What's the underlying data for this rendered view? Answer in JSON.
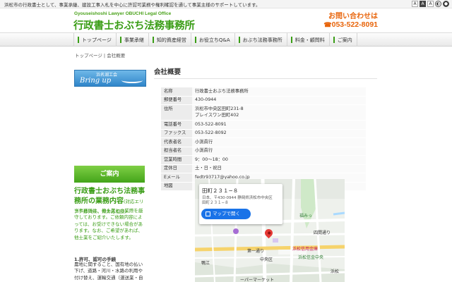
{
  "topbar": {
    "tagline": "浜松市の行政書士として、事業承継、建設工事入札を中心に許認可業務や権利確認を通して事業主様のサポートしています。",
    "font_small": "A",
    "font_mid": "A",
    "font_large": "A"
  },
  "header": {
    "subtitle": "Gyouseishoshi Lawyer OBUCHI Legal Office",
    "title": "行政書士おぶち法務事務所",
    "contact_label": "お問い合わせは",
    "phone_icon": "☎",
    "phone": "053-522-8091"
  },
  "nav": {
    "items": [
      {
        "label": "トップページ"
      },
      {
        "label": "事業承継"
      },
      {
        "label": "知的資産経営"
      },
      {
        "label": "お役立ちQ&A"
      },
      {
        "label": "おぶち法務事務所"
      },
      {
        "label": "料金・顧問料"
      },
      {
        "label": "ご案内"
      }
    ]
  },
  "breadcrumb": {
    "text": "トップページ | 会社概要"
  },
  "sidebar": {
    "banner_top": "浜名湖工会",
    "banner_main": "Bring up",
    "guide_button": "ご案内",
    "heading": "行政書士おぶち法務事務所の業務内容",
    "heading_note": "(対応エリア：静岡県、県外応相談)",
    "body": "当事務所は、他士業との業際を厳守しております。ご依頼内容によっては、お受けできない場合があります。なお、ご希望があれば、他士業をご紹介いたします。",
    "section_title": "1.許可、認可の手続",
    "section_body": "農地に関すること、国有地の払い下げ、道路・河川・水路の利用や付け替え、運輸交通（運送業・自"
  },
  "main": {
    "heading": "会社概要",
    "table": [
      {
        "label": "名称",
        "value": "行政書士おぶち法務事務所"
      },
      {
        "label": "郵便番号",
        "value": "430-0944"
      },
      {
        "label": "住所",
        "value": "浜松市中央区田町231-8",
        "value2": "プレイスワン田町402"
      },
      {
        "label": "電話番号",
        "value": "053-522-8091"
      },
      {
        "label": "ファックス",
        "value": "053-522-8092"
      },
      {
        "label": "代表者名",
        "value": "小渕眞行"
      },
      {
        "label": "担当者名",
        "value": "小渕眞行"
      },
      {
        "label": "営業時間",
        "value": "9：00～18：00"
      },
      {
        "label": "定休日",
        "value": "土・日・祝日"
      },
      {
        "label": "Eメール",
        "value": "fedtr93717@yahoo.co.jp"
      },
      {
        "label": "地図",
        "value": ""
      }
    ]
  },
  "map": {
    "card_title": "田町２３１−８",
    "card_addr1": "日本、〒430-0944 静岡県浜松市中央区",
    "card_addr2": "田町２３１−８",
    "card_button": "マップで開く",
    "labels": {
      "fukumi": "福みっ",
      "shijimi": "四間通り",
      "ichibandori": "第一通り",
      "chuoku": "中央区",
      "bank": "浜松信用金庫",
      "hamamatsucho": "浜松信金中央",
      "aikawa": "鴨江",
      "market": "ーパーマーケット",
      "hamamatsu": "浜松"
    },
    "colors": {
      "land": "#eef1ec",
      "road": "#ffffff",
      "main_road": "#f6d36b",
      "water": "#aadaff",
      "park": "#cfe9c8",
      "pin": "#e53935"
    }
  }
}
